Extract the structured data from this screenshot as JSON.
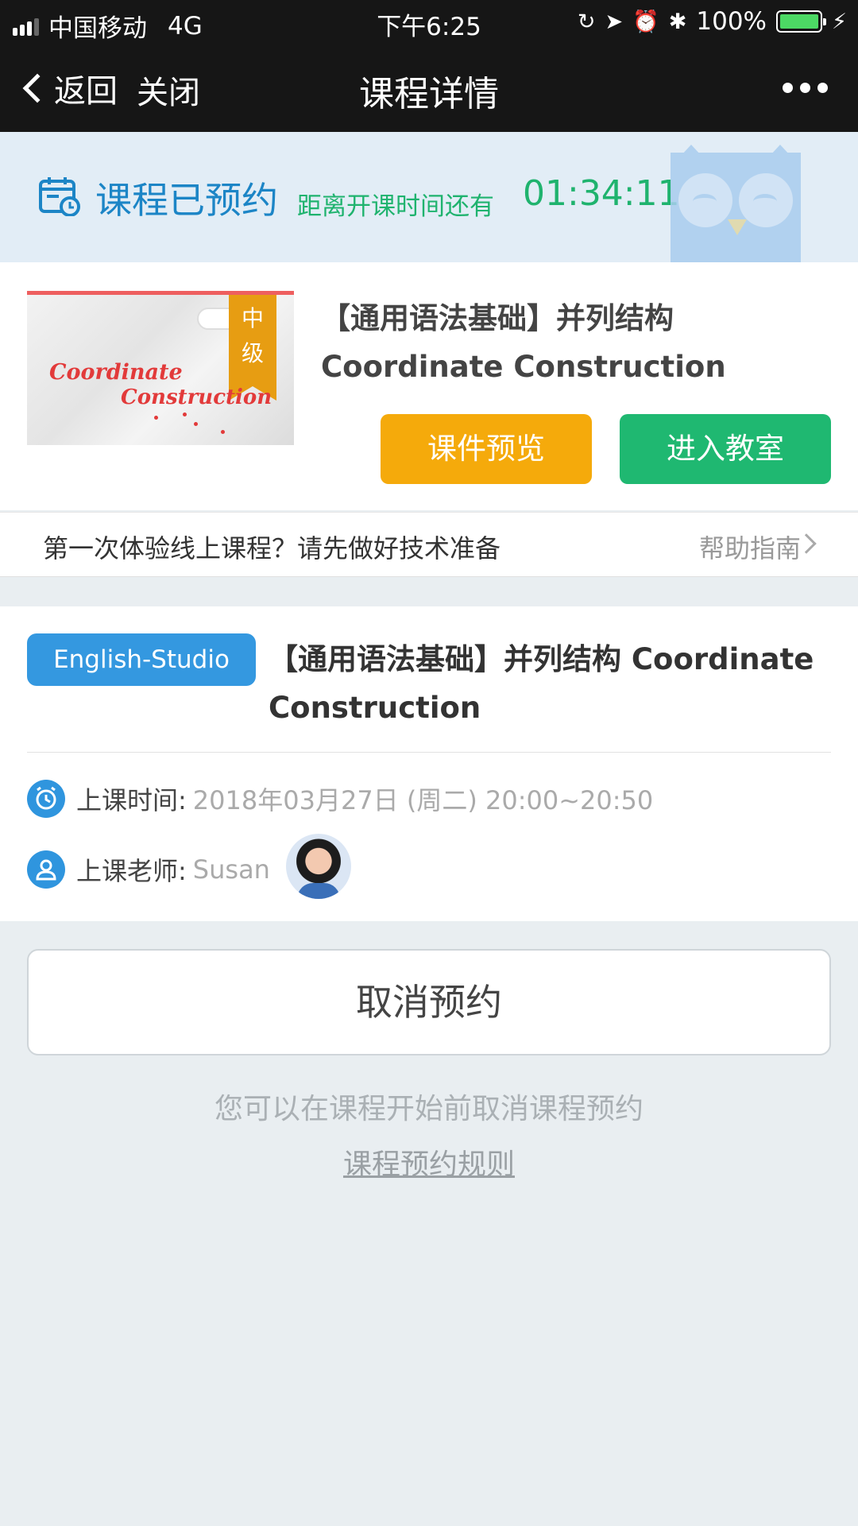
{
  "status_bar": {
    "carrier": "中国移动",
    "network": "4G",
    "time": "下午6:25",
    "battery": "100%",
    "battery_level": 1.0
  },
  "nav": {
    "back": "返回",
    "close": "关闭",
    "title": "课程详情"
  },
  "banner": {
    "status": "课程已预约",
    "countdown_label": "距离开课时间还有",
    "countdown": "01:34:11"
  },
  "course": {
    "thumbnail": {
      "level_char1": "中",
      "level_char2": "级",
      "line1": "Coordinate",
      "line2": "Construction"
    },
    "title": "【通用语法基础】并列结构 Coordinate Construction",
    "preview_button": "课件预览",
    "enter_button": "进入教室"
  },
  "help": {
    "text": "第一次体验线上课程？请先做好技术准备",
    "link": "帮助指南"
  },
  "detail": {
    "tag": "English-Studio",
    "title": "【通用语法基础】并列结构 Coordinate Construction",
    "time_label": "上课时间:",
    "time_value": "2018年03月27日 (周二) 20:00~20:50",
    "teacher_label": "上课老师:",
    "teacher_value": "Susan"
  },
  "cancel": {
    "button": "取消预约",
    "note": "您可以在课程开始前取消课程预约",
    "rule_link": "课程预约规则"
  },
  "colors": {
    "accent_blue": "#1c85c6",
    "countdown_green": "#1fb36e",
    "preview_orange": "#f5aa0b",
    "enter_green": "#1fb871",
    "tag_blue": "#3498e0"
  }
}
